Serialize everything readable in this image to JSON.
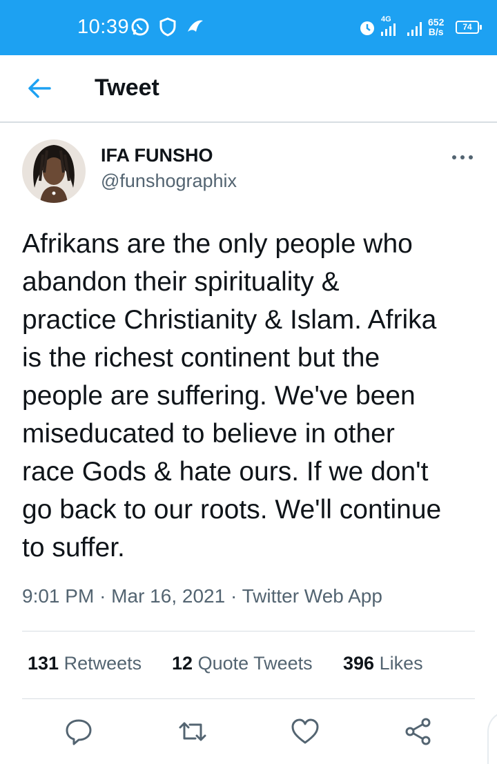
{
  "status_bar": {
    "time": "10:39",
    "network_type": "4G",
    "speed_value": "652",
    "speed_unit": "B/s",
    "battery": "74",
    "icons": [
      "whatsapp-icon",
      "shield-icon",
      "bird-icon",
      "alarm-icon",
      "signal-icon",
      "signal-icon"
    ]
  },
  "header": {
    "title": "Tweet",
    "back_icon": "arrow-left-icon"
  },
  "tweet": {
    "author_name": "IFA FUNSHO",
    "author_handle": "@funshographix",
    "text_lines": [
      "Afrikans are the only people who",
      "abandon their spirituality &",
      "practice Christianity & Islam. Afrika",
      "is the richest continent but the",
      "people are suffering. We've been",
      "miseducated to believe in other",
      "race Gods & hate ours. If we don't",
      "go back to our roots. We'll continue",
      "to suffer."
    ],
    "time": "9:01 PM",
    "separator": "·",
    "date": "Mar 16, 2021",
    "source": "Twitter Web App"
  },
  "stats": {
    "retweets_count": "131",
    "retweets_label": "Retweets",
    "quotes_count": "12",
    "quotes_label": "Quote Tweets",
    "likes_count": "396",
    "likes_label": "Likes"
  },
  "actions": [
    "reply-icon",
    "retweet-icon",
    "like-icon",
    "share-icon"
  ],
  "colors": {
    "accent": "#1da1f2",
    "secondary_text": "#536471",
    "primary_text": "#0f1419",
    "divider": "#d7dde2"
  }
}
